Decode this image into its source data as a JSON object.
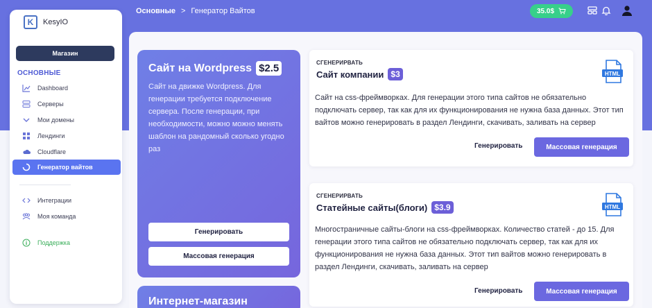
{
  "sidebar": {
    "logo_text": "KesyIO",
    "shop_button": "Магазин",
    "section_title": "ОСНОВНЫЕ",
    "items": [
      {
        "label": "Dashboard"
      },
      {
        "label": "Серверы"
      },
      {
        "label": "Мои домены"
      },
      {
        "label": "Лендинги"
      },
      {
        "label": "Cloudflare"
      },
      {
        "label": "Генератор вайтов"
      }
    ],
    "items2": [
      {
        "label": "Интеграции"
      },
      {
        "label": "Моя команда"
      }
    ],
    "support": "Поддержка"
  },
  "header": {
    "breadcrumb_root": "Основные",
    "breadcrumb_sep": ">",
    "breadcrumb_current": "Генератор Вайтов",
    "balance": "35.0$"
  },
  "featured": {
    "title": "Сайт на Wordpress",
    "price": "$2.5",
    "description": "Сайт на движке Wordpress. Для генерации требуется подключение сервера. После генерации, при необходимости, можно можно менять шаблон на рандомный сколько угодно раз",
    "generate_button": "Генерировать",
    "mass_button": "Массовая генерация"
  },
  "featured2": {
    "title": "Интернет-магазин"
  },
  "cards": [
    {
      "label": "СГЕНЕРИРВАТЬ",
      "title": "Сайт компании",
      "price": "$3",
      "description": "Сайт на css-фреймворках. Для генерации этого типа сайтов не обязательно подключать сервер, так как для их функционирования не нужна база данных. Этот тип вайтов можно генерировать в раздел Лендинги, скачивать, заливать на сервер",
      "generate_button": "Генерировать",
      "mass_button": "Массовая генерация"
    },
    {
      "label": "СГЕНЕРИРВАТЬ",
      "title": "Статейные сайты(блоги)",
      "price": "$3.9",
      "description": "Многостраничные сайты-блоги на css-фреймворках. Количество статей - до 15. Для генерации этого типа сайтов не обязательно подключать сервер, так как для их функционирования не нужна база данных. Этот тип вайтов можно генерировать в раздел Лендинги, скачивать, заливать на сервер",
      "generate_button": "Генерировать",
      "mass_button": "Массовая генерация"
    }
  ],
  "colors": {
    "accent": "#6771e0",
    "active_nav": "#5a74f0",
    "balance": "#37d08a",
    "price_badge": "#6c5fd8"
  }
}
